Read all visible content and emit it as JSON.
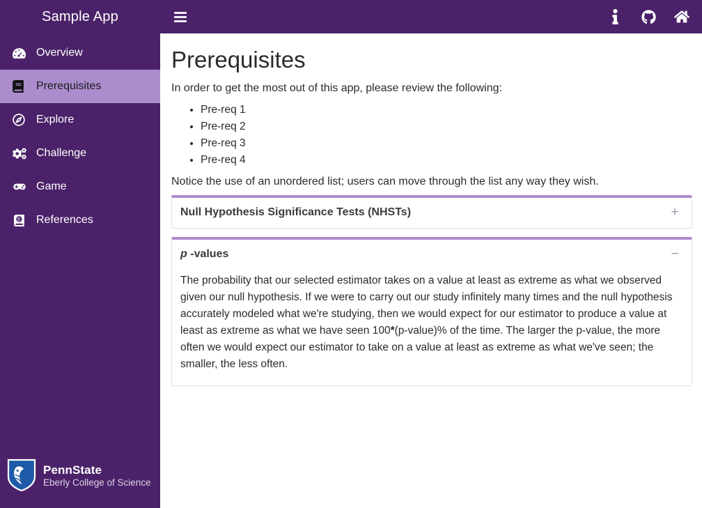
{
  "app": {
    "brand": "Sample App"
  },
  "sidebar": {
    "items": [
      {
        "label": "Overview",
        "icon": "tachometer-icon",
        "active": false
      },
      {
        "label": "Prerequisites",
        "icon": "book-icon",
        "active": true
      },
      {
        "label": "Explore",
        "icon": "compass-icon",
        "active": false
      },
      {
        "label": "Challenge",
        "icon": "cogs-icon",
        "active": false
      },
      {
        "label": "Game",
        "icon": "gamepad-icon",
        "active": false
      },
      {
        "label": "References",
        "icon": "atlas-icon",
        "active": false
      }
    ],
    "logo": {
      "name": "PennState",
      "subtitle": "Eberly College of Science",
      "shield_color": "#1e5aa8",
      "icon": "penn-state-shield-icon"
    }
  },
  "topbar": {
    "menu_icon": "hamburger-menu-icon",
    "icons": [
      {
        "name": "info-icon",
        "glyph": "i"
      },
      {
        "name": "github-icon",
        "glyph": "github"
      },
      {
        "name": "home-icon",
        "glyph": "home"
      }
    ]
  },
  "main": {
    "title": "Prerequisites",
    "intro": "In order to get the most out of this app, please review the following:",
    "prereqs": [
      "Pre-req 1",
      "Pre-req 2",
      "Pre-req 3",
      "Pre-req 4"
    ],
    "note": "Notice the use of an unordered list; users can move through the list any way they wish.",
    "accordion": [
      {
        "title": "Null Hypothesis Significance Tests (NHSTs)",
        "toggle": "+",
        "expanded": false,
        "body": ""
      },
      {
        "title_prefix_italic": "p",
        "title_rest": "-values",
        "toggle": "−",
        "expanded": true,
        "body_part_1": "The probability that our selected estimator takes on a value at least as extreme as what we observed given our null hypothesis. If we were to carry out our study infinitely many times and the null hypothesis accurately modeled what we're studying, then we would expect for our estimator to produce a value at least as extreme as what we have seen 100",
        "body_bold": "*",
        "body_part_2": "(p-value)% of the time. The larger the p-value, the more often we would expect our estimator to take on a value at least as extreme as what we've seen; the smaller, the less often."
      }
    ]
  },
  "colors": {
    "sidebar_bg": "#4b2269",
    "active_item_bg": "#ab8ccd",
    "panel_accent": "#ab8ccd",
    "text": "#2b2b2b",
    "toggle": "#9a9ab0"
  }
}
